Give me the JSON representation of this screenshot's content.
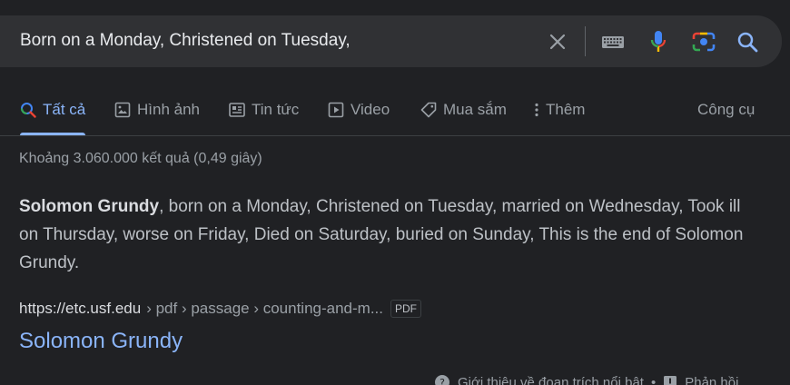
{
  "search": {
    "query": "Born on a Monday, Christened on Tuesday,"
  },
  "icons": {
    "clear": "close-icon",
    "keyboard": "keyboard-icon",
    "mic": "microphone-icon",
    "lens": "camera-lens-icon",
    "search": "search-icon"
  },
  "tabs": [
    {
      "label": "Tất cả",
      "icon": "search-icon"
    },
    {
      "label": "Hình ảnh",
      "icon": "image-icon"
    },
    {
      "label": "Tin tức",
      "icon": "news-icon"
    },
    {
      "label": "Video",
      "icon": "play-icon"
    },
    {
      "label": "Mua sắm",
      "icon": "tag-icon"
    },
    {
      "label": "Thêm",
      "icon": "more-vert-icon"
    }
  ],
  "tools_label": "Công cụ",
  "result_stats": "Khoảng 3.060.000 kết quả (0,49 giây)",
  "snippet": {
    "bold": "Solomon Grundy",
    "text": ", born on a Monday, Christened on Tuesday, married on Wednesday, Took ill on Thursday, worse on Friday, Died on Saturday, buried on Sunday, This is the end of Solomon Grundy."
  },
  "result": {
    "domain": "https://etc.usf.edu",
    "path": "› pdf › passage › counting-and-m...",
    "badge": "PDF",
    "title": "Solomon Grundy"
  },
  "footer": {
    "about": "Giới thiệu về đoạn trích nổi bật",
    "feedback": "Phản hồi"
  },
  "colors": {
    "background": "#202124",
    "accent": "#8ab4f8",
    "search_bar": "#303134"
  }
}
